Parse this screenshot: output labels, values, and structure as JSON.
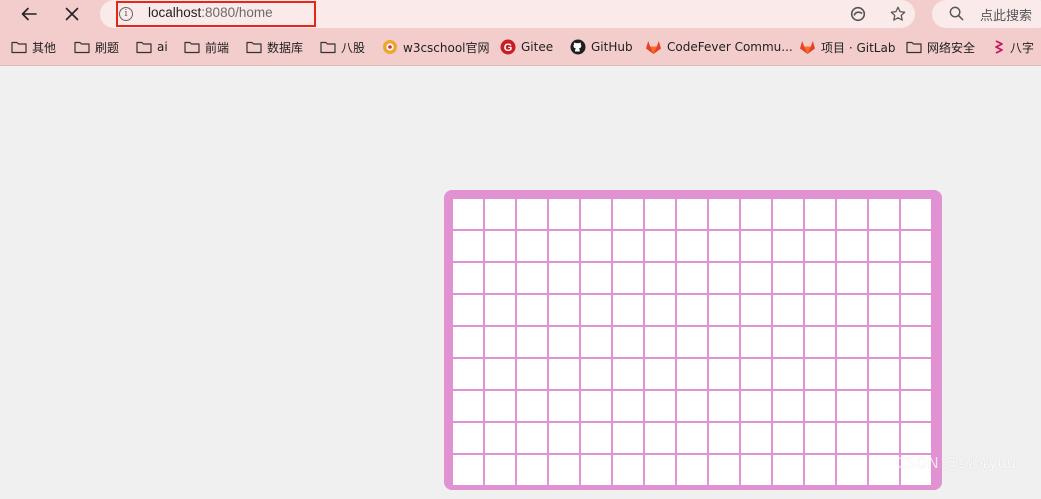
{
  "browser": {
    "url_host": "localhost",
    "url_rest": ":8080/home",
    "search_placeholder": "点此搜索"
  },
  "bookmarks": [
    {
      "label": "其他",
      "icon": "folder-icon"
    },
    {
      "label": "刷题",
      "icon": "folder-icon"
    },
    {
      "label": "ai",
      "icon": "folder-icon"
    },
    {
      "label": "前端",
      "icon": "folder-icon"
    },
    {
      "label": "数据库",
      "icon": "folder-icon"
    },
    {
      "label": "八股",
      "icon": "folder-icon"
    },
    {
      "label": "w3cschool官网",
      "icon": "w3cschool-icon"
    },
    {
      "label": "Gitee",
      "icon": "gitee-icon"
    },
    {
      "label": "GitHub",
      "icon": "github-icon"
    },
    {
      "label": "CodeFever Commu...",
      "icon": "gitlab-icon"
    },
    {
      "label": "项目 · GitLab",
      "icon": "gitlab-icon"
    },
    {
      "label": "网络安全",
      "icon": "folder-icon"
    },
    {
      "label": "八字",
      "icon": "app-icon"
    }
  ],
  "board": {
    "rows": 9,
    "cols": 15,
    "border_color": "#e192d2",
    "cell_color": "#ffffff"
  },
  "watermark": "CSDN @绒绒yuu"
}
